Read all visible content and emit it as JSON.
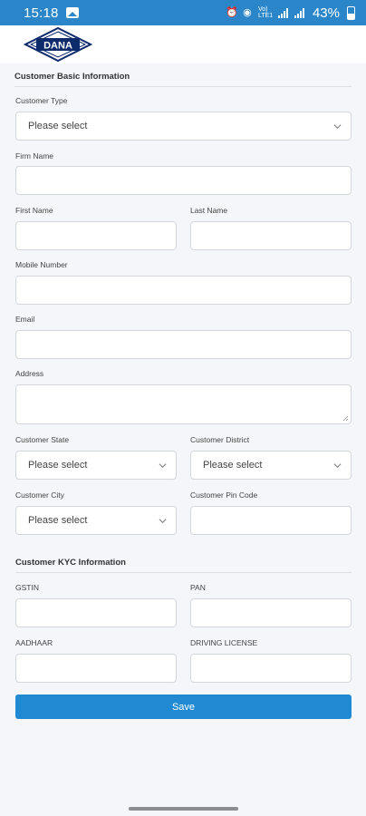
{
  "status_bar": {
    "time": "15:18",
    "battery": "43%",
    "network": "Vo) LTE1"
  },
  "header": {
    "logo_text": "DANA"
  },
  "sections": {
    "basic": "Customer Basic Information",
    "kyc": "Customer KYC Information"
  },
  "fields": {
    "customer_type": {
      "label": "Customer Type",
      "value": "Please select"
    },
    "firm_name": {
      "label": "Firm Name",
      "value": ""
    },
    "first_name": {
      "label": "First Name",
      "value": ""
    },
    "last_name": {
      "label": "Last Name",
      "value": ""
    },
    "mobile_number": {
      "label": "Mobile Number",
      "value": ""
    },
    "email": {
      "label": "Email",
      "value": ""
    },
    "address": {
      "label": "Address",
      "value": ""
    },
    "customer_state": {
      "label": "Customer State",
      "value": "Please select"
    },
    "customer_district": {
      "label": "Customer District",
      "value": "Please select"
    },
    "customer_city": {
      "label": "Customer City",
      "value": "Please select"
    },
    "customer_pin_code": {
      "label": "Customer Pin Code",
      "value": ""
    },
    "gstin": {
      "label": "GSTIN",
      "value": ""
    },
    "pan": {
      "label": "PAN",
      "value": ""
    },
    "aadhaar": {
      "label": "AADHAAR",
      "value": ""
    },
    "driving_license": {
      "label": "DRIVING LICENSE",
      "value": ""
    }
  },
  "actions": {
    "save": "Save"
  },
  "colors": {
    "accent": "#1f8ad2",
    "status_bar": "#2a86c8",
    "page_bg": "#f4f6f9",
    "logo_navy": "#0d2a6b"
  }
}
